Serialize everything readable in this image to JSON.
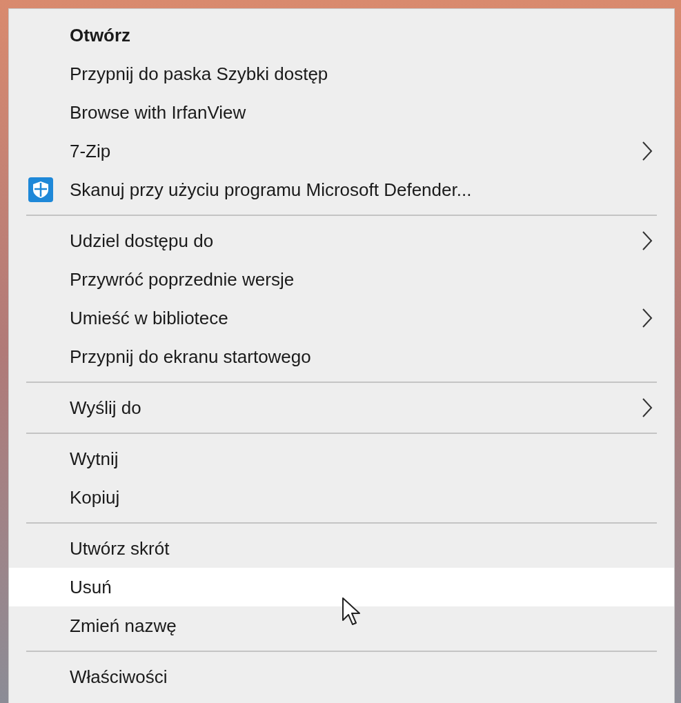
{
  "menu": {
    "groups": [
      {
        "items": [
          {
            "label": "Otwórz",
            "bold": true,
            "submenu": false,
            "highlighted": false
          },
          {
            "label": "Przypnij do paska Szybki dostęp",
            "bold": false,
            "submenu": false,
            "highlighted": false
          },
          {
            "label": "Browse with IrfanView",
            "bold": false,
            "submenu": false,
            "highlighted": false
          },
          {
            "label": "7-Zip",
            "bold": false,
            "submenu": true,
            "highlighted": false
          },
          {
            "label": "Skanuj przy użyciu programu Microsoft Defender...",
            "bold": false,
            "submenu": false,
            "highlighted": false,
            "kind": "scan"
          }
        ]
      },
      {
        "items": [
          {
            "label": "Udziel dostępu do",
            "bold": false,
            "submenu": true,
            "highlighted": false
          },
          {
            "label": "Przywróć poprzednie wersje",
            "bold": false,
            "submenu": false,
            "highlighted": false
          },
          {
            "label": "Umieść w bibliotece",
            "bold": false,
            "submenu": true,
            "highlighted": false
          },
          {
            "label": "Przypnij do ekranu startowego",
            "bold": false,
            "submenu": false,
            "highlighted": false
          }
        ]
      },
      {
        "items": [
          {
            "label": "Wyślij do",
            "bold": false,
            "submenu": true,
            "highlighted": false
          }
        ]
      },
      {
        "items": [
          {
            "label": "Wytnij",
            "bold": false,
            "submenu": false,
            "highlighted": false
          },
          {
            "label": "Kopiuj",
            "bold": false,
            "submenu": false,
            "highlighted": false
          }
        ]
      },
      {
        "items": [
          {
            "label": "Utwórz skrót",
            "bold": false,
            "submenu": false,
            "highlighted": false
          },
          {
            "label": "Usuń",
            "bold": false,
            "submenu": false,
            "highlighted": true
          },
          {
            "label": "Zmień nazwę",
            "bold": false,
            "submenu": false,
            "highlighted": false
          }
        ]
      },
      {
        "items": [
          {
            "label": "Właściwości",
            "bold": false,
            "submenu": false,
            "highlighted": false
          }
        ]
      }
    ]
  }
}
